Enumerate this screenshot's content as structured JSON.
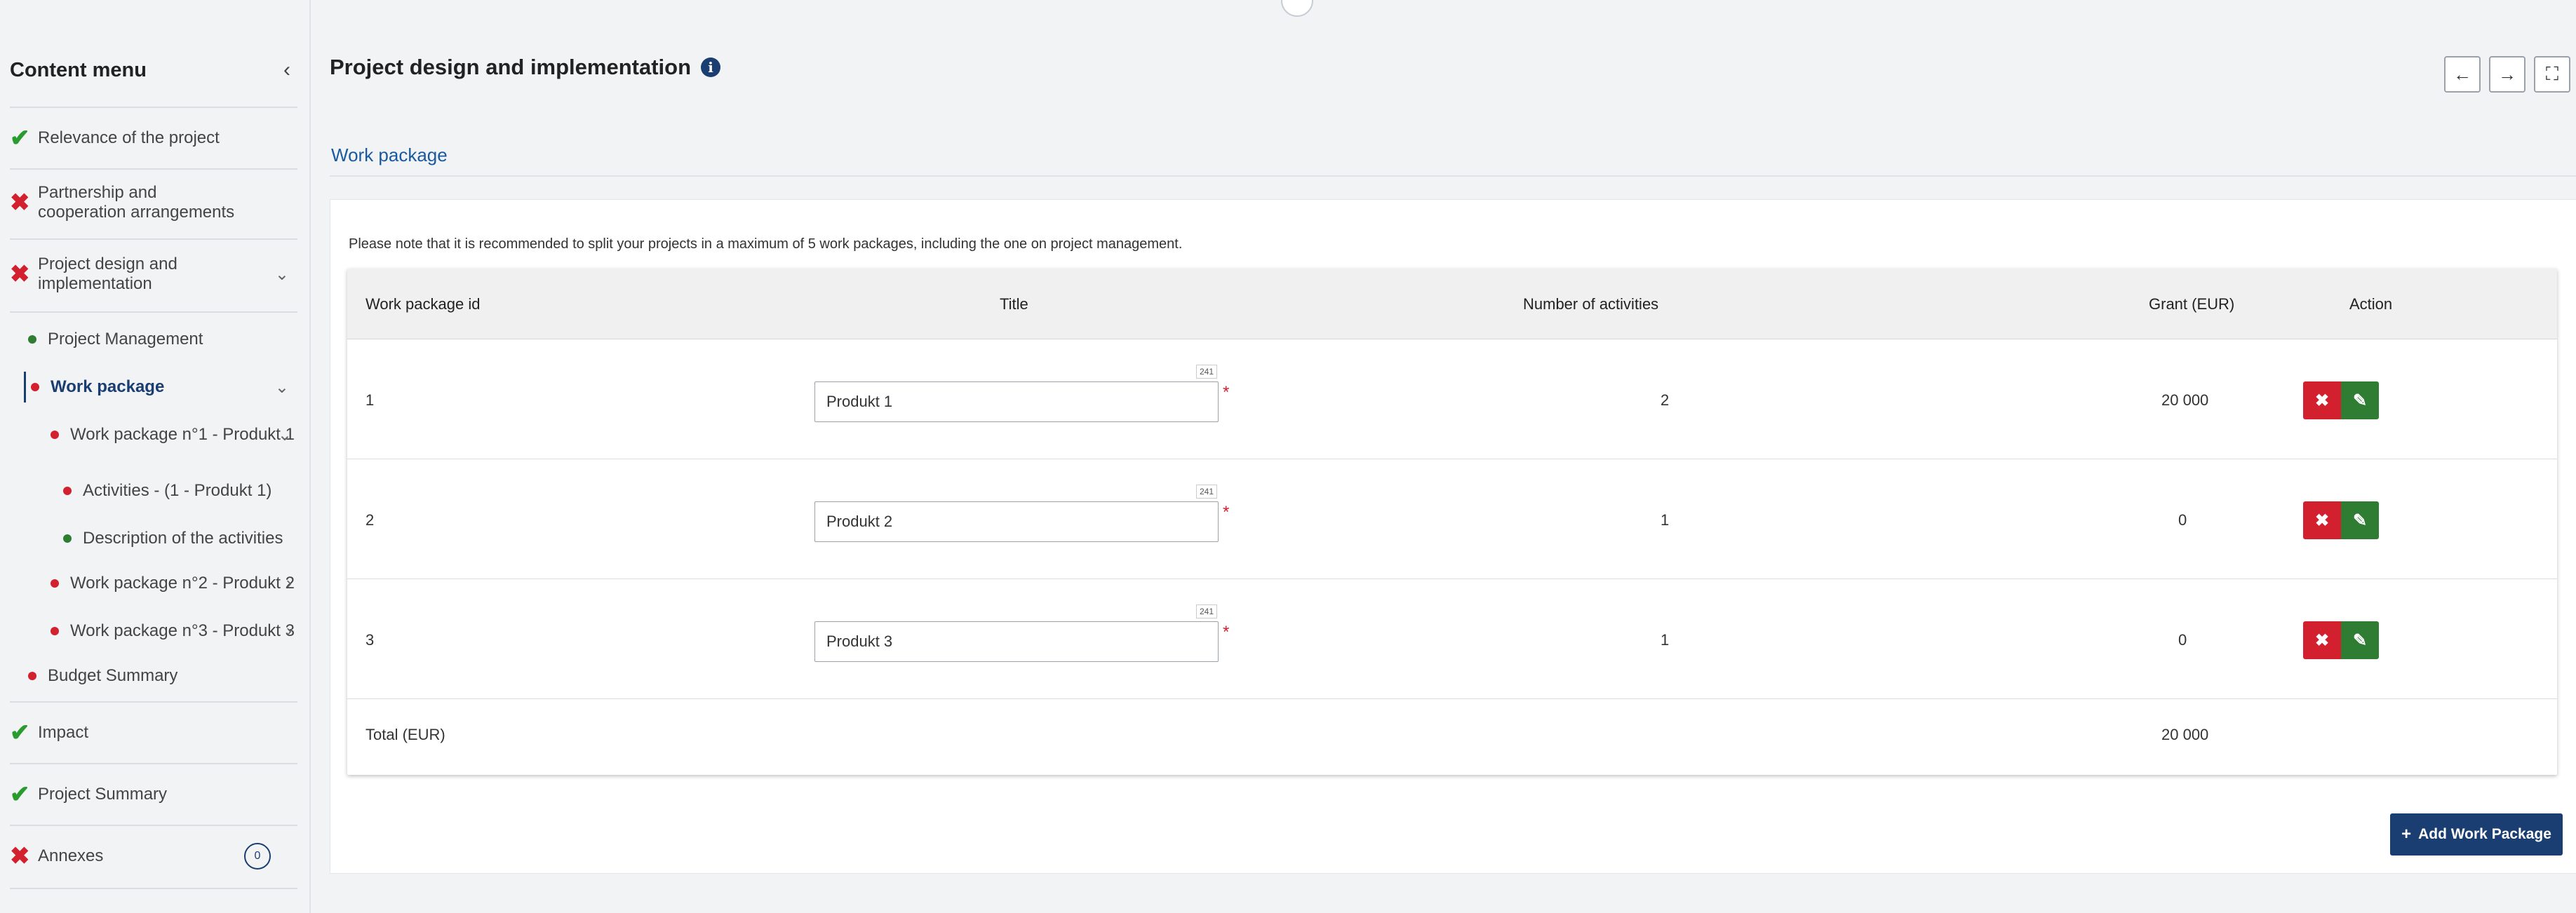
{
  "sidebar": {
    "title": "Content menu",
    "collapse_icon": "‹",
    "items": [
      {
        "label": "Relevance of the project",
        "status": "check"
      },
      {
        "label": "Partnership and cooperation arrangements",
        "status": "cross"
      },
      {
        "label": "Project design and implementation",
        "status": "cross",
        "chevron": "⌄"
      },
      {
        "label": "Project Management",
        "status": "green-dot"
      },
      {
        "label": "Work package",
        "status": "red-dot",
        "chevron": "⌄"
      },
      {
        "label": "Work package n°1 - Produkt 1",
        "status": "red-dot",
        "chevron": "⌄"
      },
      {
        "label": "Activities - (1 - Produkt 1)",
        "status": "red-dot"
      },
      {
        "label": "Description of the activities",
        "status": "green-dot"
      },
      {
        "label": "Work package n°2 - Produkt 2",
        "status": "red-dot",
        "chevron": "›"
      },
      {
        "label": "Work package n°3 - Produkt 3",
        "status": "red-dot",
        "chevron": "›"
      },
      {
        "label": "Budget Summary",
        "status": "red-dot"
      },
      {
        "label": "Impact",
        "status": "check"
      },
      {
        "label": "Project Summary",
        "status": "check"
      },
      {
        "label": "Annexes",
        "status": "cross",
        "badge": "0"
      }
    ]
  },
  "header": {
    "title": "Project design and implementation",
    "info_icon": "i",
    "nav": {
      "back": "←",
      "forward": "→",
      "fullscreen": "⛶"
    }
  },
  "breadcrumb": "Work package",
  "note": "Please note that it is recommended to split your projects in a maximum of 5 work packages, including the one on project management.",
  "table": {
    "columns": [
      "Work package id",
      "Title",
      "Number of activities",
      "Grant (EUR)",
      "Action"
    ],
    "rows": [
      {
        "id": "1",
        "title": "Produkt 1",
        "counter": "241",
        "activities": "2",
        "grant": "20 000"
      },
      {
        "id": "2",
        "title": "Produkt 2",
        "counter": "241",
        "activities": "1",
        "grant": "0"
      },
      {
        "id": "3",
        "title": "Produkt 3",
        "counter": "241",
        "activities": "1",
        "grant": "0"
      }
    ],
    "total_label": "Total (EUR)",
    "total_grant": "20 000",
    "delete_icon": "✖",
    "edit_icon": "✎",
    "required_mark": "*"
  },
  "add_button": {
    "icon": "+",
    "label": "Add Work Package"
  },
  "colors": {
    "primary": "#1a3e72",
    "danger": "#d3202e",
    "success": "#2f7d32"
  }
}
